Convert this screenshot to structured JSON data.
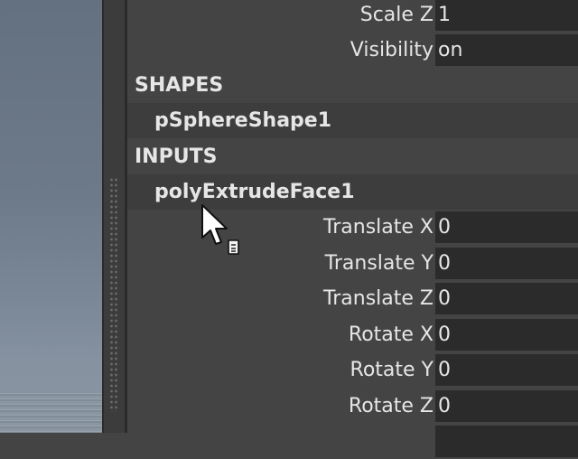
{
  "attributes_top": [
    {
      "label": "Scale Z",
      "value": "1"
    },
    {
      "label": "Visibility",
      "value": "on"
    }
  ],
  "shapes": {
    "header": "SHAPES",
    "node": "pSphereShape1"
  },
  "inputs": {
    "header": "INPUTS",
    "node": "polyExtrudeFace1",
    "attributes": [
      {
        "label": "Translate X",
        "value": "0"
      },
      {
        "label": "Translate Y",
        "value": "0"
      },
      {
        "label": "Translate Z",
        "value": "0"
      },
      {
        "label": "Rotate X",
        "value": "0"
      },
      {
        "label": "Rotate Y",
        "value": "0"
      },
      {
        "label": "Rotate Z",
        "value": "0"
      }
    ]
  },
  "cursor": {
    "icon": "pointer-with-menu-icon"
  },
  "colors": {
    "panel_bg": "#444444",
    "field_bg": "#2b2b2b",
    "node_row_bg": "#3d3d3d",
    "text": "#e6e6e6"
  }
}
